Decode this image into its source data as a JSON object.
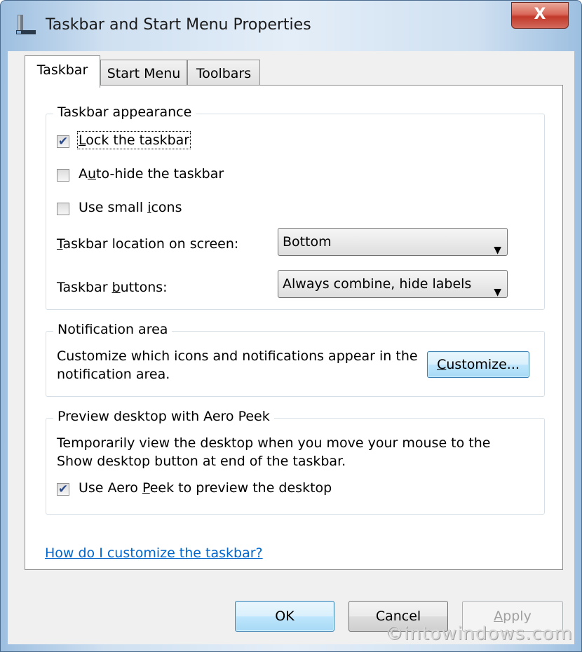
{
  "window": {
    "title": "Taskbar and Start Menu Properties",
    "close_label": "X"
  },
  "tabs": [
    {
      "label": "Taskbar",
      "active": true
    },
    {
      "label": "Start Menu",
      "active": false
    },
    {
      "label": "Toolbars",
      "active": false
    }
  ],
  "taskbar_appearance": {
    "legend": "Taskbar appearance",
    "lock": {
      "pre": "",
      "key": "L",
      "post": "ock the taskbar",
      "checked": true
    },
    "autohide": {
      "pre": "A",
      "key": "u",
      "post": "to-hide the taskbar",
      "checked": false
    },
    "small_icons": {
      "pre": "Use small ",
      "key": "i",
      "post": "cons",
      "checked": false
    },
    "location": {
      "label_key": "T",
      "label_rest": "askbar location on screen:",
      "value": "Bottom"
    },
    "buttons": {
      "label_pre": "Taskbar ",
      "label_key": "b",
      "label_post": "uttons:",
      "value": "Always combine, hide labels"
    }
  },
  "notification_area": {
    "legend": "Notification area",
    "text_line1": "Customize which icons and notifications appear in the",
    "text_line2": "notification area.",
    "customize": {
      "key": "C",
      "rest": "ustomize..."
    }
  },
  "aero_peek": {
    "legend": "Preview desktop with Aero Peek",
    "text_line1": "Temporarily view the desktop when you move your mouse to the",
    "text_line2": "Show desktop button at end of the taskbar.",
    "checkbox": {
      "pre": "Use Aero ",
      "key": "P",
      "post": "eek to preview the desktop",
      "checked": true
    }
  },
  "help_link": "How do I customize the taskbar?",
  "buttons": {
    "ok": "OK",
    "cancel": "Cancel",
    "apply_key": "A",
    "apply_rest": "pply"
  },
  "watermark": "©intowindows.com",
  "colors": {
    "link": "#0066cc",
    "close_button": "#c2392a",
    "default_button": "#3c7fb1"
  }
}
